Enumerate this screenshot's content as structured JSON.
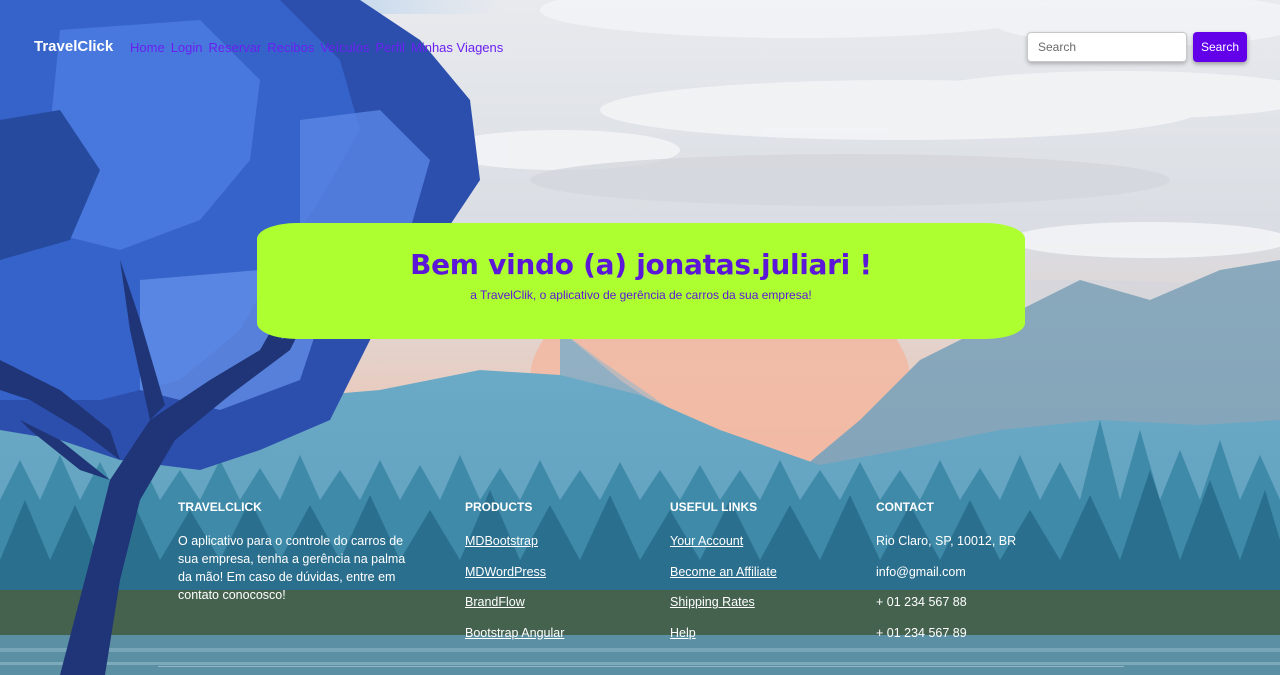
{
  "navbar": {
    "brand": "TravelClick",
    "links": [
      "Home",
      "Login",
      "Reservar",
      "Recibos",
      "Veículos",
      "Perfil",
      "Minhas Viagens"
    ],
    "search": {
      "placeholder": "Search",
      "button_label": "Search"
    }
  },
  "hero": {
    "greeting": "Bem vindo (a)",
    "username": "jonatas.juliari",
    "exclaim": "!",
    "subtitle": "a TravelClik, o aplicativo de gerência de carros da sua empresa!"
  },
  "footer": {
    "about": {
      "heading": "TravelClick",
      "text": "O aplicativo para o controle do carros de sua empresa, tenha a gerência na palma da mão! Em caso de dúvidas, entre em contato conocosco!"
    },
    "products": {
      "heading": "Products",
      "items": [
        "MDBootstrap",
        "MDWordPress",
        "BrandFlow",
        "Bootstrap Angular"
      ]
    },
    "useful_links": {
      "heading": "Useful links",
      "items": [
        "Your Account",
        "Become an Affiliate",
        "Shipping Rates",
        "Help"
      ]
    },
    "contact": {
      "heading": "Contact",
      "items": [
        "Rio Claro, SP, 10012, BR",
        "info@gmail.com",
        "+ 01 234 567 88",
        "+ 01 234 567 89"
      ]
    }
  },
  "colors": {
    "accent": "#6200ea",
    "hero_bg": "#adff2f",
    "hero_text": "#5b16d8",
    "nav_link": "#6a1ff0"
  },
  "icons": [
    "tree-illustration",
    "mountain-landscape"
  ]
}
